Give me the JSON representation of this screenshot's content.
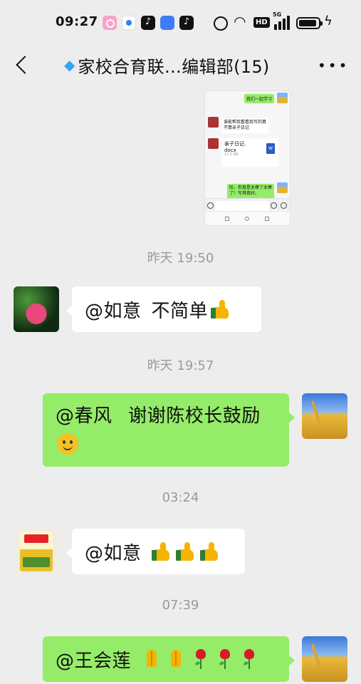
{
  "status_bar": {
    "time": "09:27",
    "network_badge": "HD",
    "signal_type": "5G",
    "icons": [
      "camera-app-icon",
      "browser-app-icon",
      "tiktok-icon",
      "chat-app-icon",
      "tiktok-icon",
      "alarm-icon",
      "wifi-icon",
      "signal-icon",
      "battery-icon",
      "charging-icon"
    ]
  },
  "header": {
    "title": "家校合育联…编辑部(15)",
    "back_icon": "chevron-left-icon",
    "more_icon": "more-dots-icon",
    "gem_icon": "diamond-icon"
  },
  "embedded_image": {
    "msg1": "我们一起学习",
    "msg2_line1": "谁能帮我看看我写的算",
    "msg2_line2": "不算亲子日记",
    "file_name": "亲子日记.",
    "file_ext": "docx",
    "file_size": "11.5 KB",
    "file_badge": "W",
    "msg3_line1": "哇，你真是太棒了太棒",
    "msg3_line2": "了！写得真好。"
  },
  "messages": [
    {
      "type": "timestamp",
      "text": "昨天 19:50"
    },
    {
      "type": "message",
      "side": "left",
      "avatar": "lotus-avatar",
      "mention": "@如意",
      "text": "不简单"
    },
    {
      "type": "timestamp",
      "text": "昨天 19:57"
    },
    {
      "type": "message",
      "side": "right",
      "avatar": "wheat-field-avatar",
      "mention": "@春风",
      "text": "谢谢陈校长鼓励"
    },
    {
      "type": "timestamp",
      "text": "03:24"
    },
    {
      "type": "message",
      "side": "left",
      "avatar": "rice-bag-avatar",
      "mention": "@如意",
      "text": ""
    },
    {
      "type": "timestamp",
      "text": "07:39"
    },
    {
      "type": "message",
      "side": "right",
      "avatar": "wheat-field-avatar",
      "mention": "@王会莲",
      "text": ""
    }
  ],
  "colors": {
    "background": "#ededed",
    "bubble_self": "#95ec69",
    "bubble_other": "#ffffff",
    "timestamp": "#9a9a9a"
  }
}
